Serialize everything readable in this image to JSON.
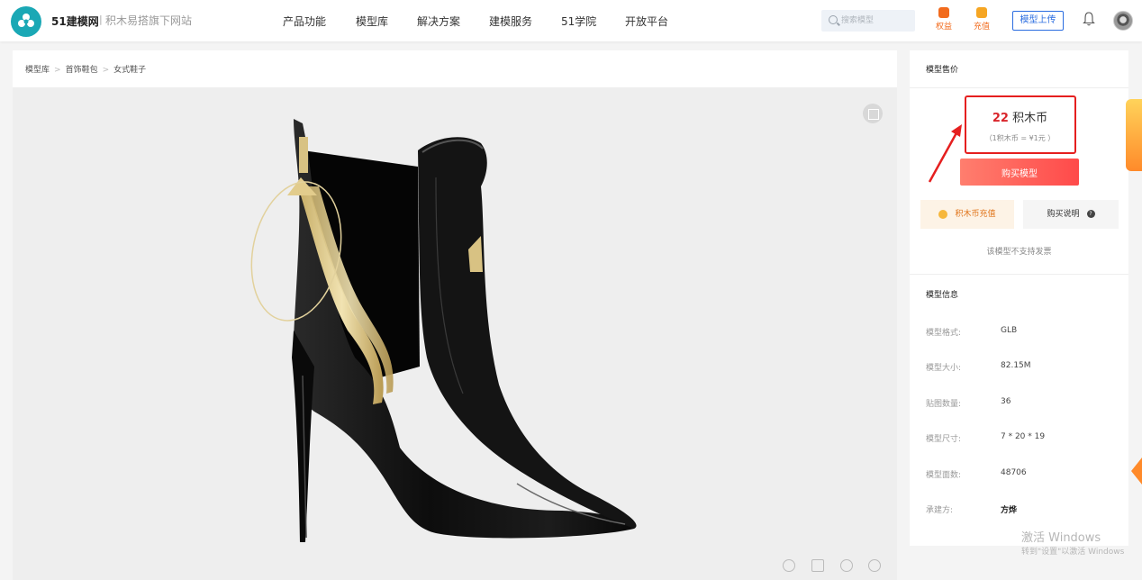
{
  "header": {
    "brand": "51建模网",
    "brand_separator": "|",
    "brand_sub": "积木易搭旗下网站",
    "nav": [
      "产品功能",
      "模型库",
      "解决方案",
      "建模服务",
      "51学院",
      "开放平台"
    ],
    "search_placeholder": "搜索模型",
    "benefits_label": "权益",
    "recharge_label": "充值",
    "upload_label": "模型上传"
  },
  "breadcrumb": [
    "模型库",
    "首饰鞋包",
    "女式鞋子"
  ],
  "price": {
    "heading": "模型售价",
    "amount": "22",
    "unit": "积木币",
    "rate": "（1积木币 = ¥1元 ）",
    "buy_label": "购买模型",
    "recharge_label": "积木币充值",
    "guide_label": "购买说明",
    "invoice_note": "该模型不支持发票"
  },
  "info": {
    "heading": "模型信息",
    "rows": [
      {
        "label": "模型格式:",
        "value": "GLB"
      },
      {
        "label": "模型大小:",
        "value": "82.15M"
      },
      {
        "label": "贴图数量:",
        "value": "36"
      },
      {
        "label": "模型尺寸:",
        "value": "7 * 20 * 19"
      },
      {
        "label": "模型面数:",
        "value": "48706"
      },
      {
        "label": "承建方:",
        "value": "方烨"
      }
    ]
  },
  "watermark": {
    "line1": "激活 Windows",
    "line2": "转到\"设置\"以激活 Windows"
  },
  "colors": {
    "accent_red": "#e51f1f",
    "brand_teal": "#1aa8b5",
    "link_blue": "#2b6de0",
    "shoe_gold": "#e8d49a"
  }
}
